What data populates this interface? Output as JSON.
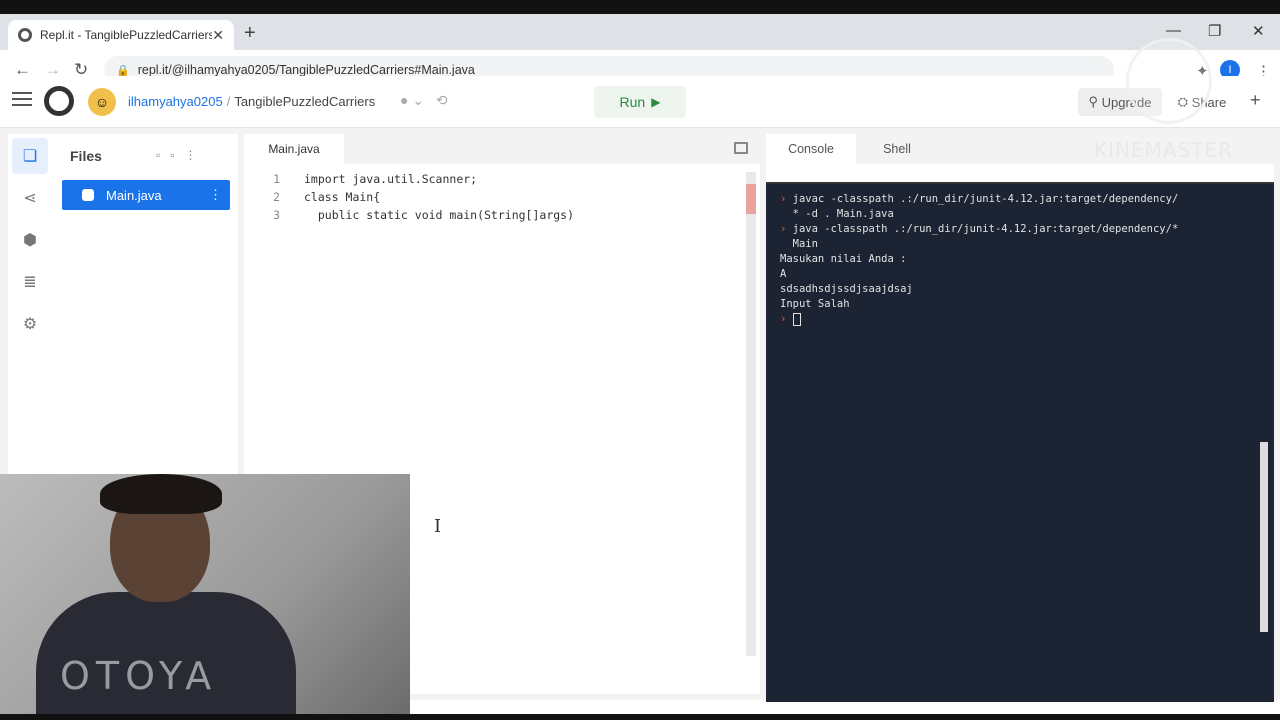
{
  "browser": {
    "tab_title": "Repl.it - TangiblePuzzledCarriers",
    "url": "repl.it/@ilhamyahya0205/TangiblePuzzledCarriers#Main.java",
    "profile_initial": "I"
  },
  "header": {
    "username": "ilhamyahya0205",
    "separator": "/",
    "repl_name": "TangiblePuzzledCarriers",
    "run_label": "Run",
    "upgrade_label": "Upgrade",
    "share_label": "Share"
  },
  "files": {
    "title": "Files",
    "items": [
      {
        "label": "Main.java"
      }
    ]
  },
  "editor": {
    "tab": "Main.java",
    "lines": [
      {
        "num": "1",
        "text": "import java.util.Scanner;"
      },
      {
        "num": "2",
        "text": "class Main{"
      },
      {
        "num": "3",
        "text": "  public static void main(String[]args)"
      }
    ]
  },
  "console": {
    "tabs": [
      {
        "label": "Console"
      },
      {
        "label": "Shell"
      }
    ],
    "lines": [
      {
        "prompt": "›",
        "text": "javac -classpath .:/run_dir/junit-4.12.jar:target/dependency/"
      },
      {
        "prompt": "",
        "text": "* -d . Main.java"
      },
      {
        "prompt": "›",
        "text": "java -classpath .:/run_dir/junit-4.12.jar:target/dependency/*"
      },
      {
        "prompt": "",
        "text": " Main"
      },
      {
        "prompt": "",
        "text": "Masukan nilai Anda :"
      },
      {
        "prompt": "",
        "text": "A"
      },
      {
        "prompt": "",
        "text": "sdsadhsdjssdjsaajdsaj"
      },
      {
        "prompt": "",
        "text": "Input Salah"
      }
    ],
    "final_prompt": "›"
  },
  "overlay": {
    "watermark": "KINEMASTER",
    "shirt_text": "OTOYA"
  },
  "colors": {
    "accent": "#1a73e8",
    "run_green": "#2a8a3a",
    "terminal_bg": "#1c2333",
    "prompt": "#e0603a"
  }
}
